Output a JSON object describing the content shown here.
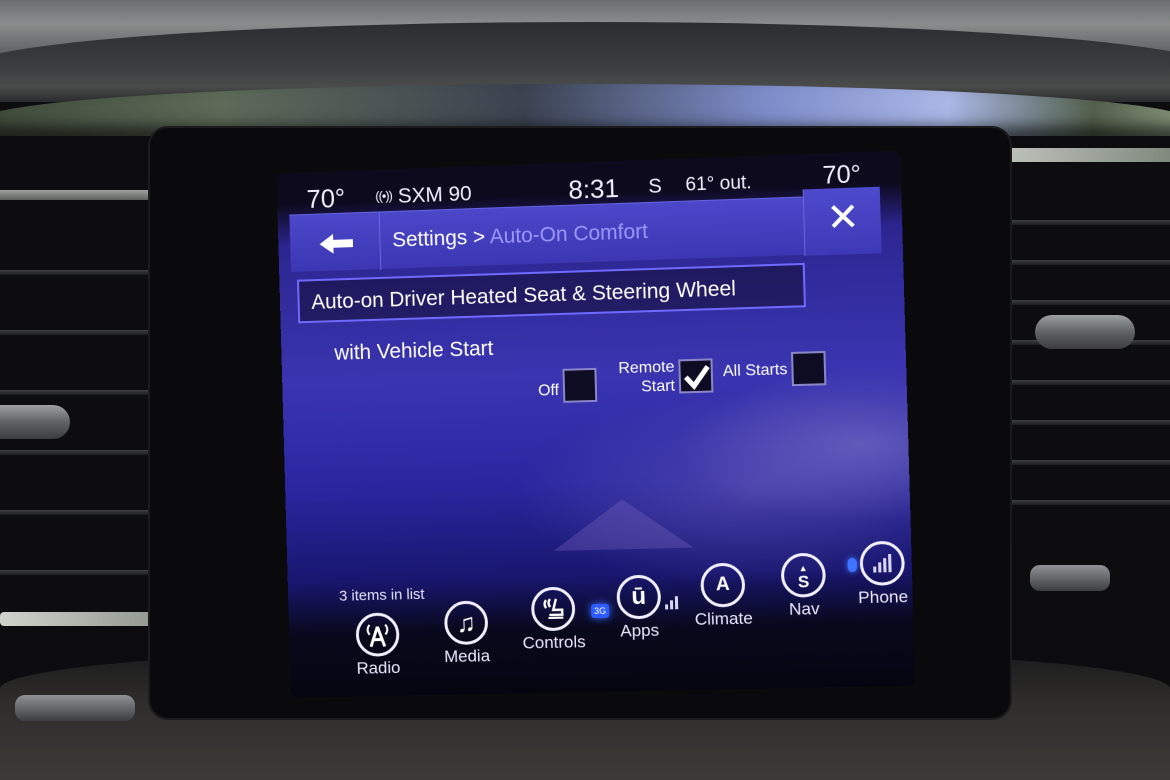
{
  "status_bar": {
    "driver_temp": "70°",
    "radio_icon": "radio-signal-icon",
    "radio_station": "SXM 90",
    "clock": "8:31",
    "compass_heading": "S",
    "outside_temp": "61° out.",
    "passenger_temp": "70°"
  },
  "header": {
    "back_icon": "back-arrow-icon",
    "breadcrumb_parent": "Settings",
    "breadcrumb_separator": " > ",
    "breadcrumb_current": "Auto-On Comfort",
    "close_icon": "close-icon"
  },
  "setting": {
    "title": "Auto-on Driver Heated Seat & Steering Wheel",
    "subtitle": "with Vehicle Start",
    "options": [
      {
        "label": "Off",
        "checked": false
      },
      {
        "label_line1": "Remote",
        "label_line2": "Start",
        "checked": true
      },
      {
        "label": "All Starts",
        "checked": false
      }
    ]
  },
  "list_info": "3 items in list",
  "nav": [
    {
      "label": "Radio",
      "icon": "radio-tower-icon",
      "glyph": "A"
    },
    {
      "label": "Media",
      "icon": "music-note-icon",
      "glyph": "♫"
    },
    {
      "label": "Controls",
      "icon": "seat-controls-icon",
      "glyph": "≋"
    },
    {
      "label": "Apps",
      "icon": "uconnect-apps-icon",
      "glyph": "ū",
      "badge": "3G"
    },
    {
      "label": "Climate",
      "icon": "climate-icon",
      "glyph": "A"
    },
    {
      "label": "Nav",
      "icon": "compass-nav-icon",
      "glyph": "S"
    },
    {
      "label": "Phone",
      "icon": "phone-signal-icon",
      "glyph": ""
    }
  ],
  "colors": {
    "accent": "#6f69ff",
    "header_bg": "#4c47c9",
    "current_crumb": "#9d97ff",
    "badge": "#2d5bff"
  }
}
